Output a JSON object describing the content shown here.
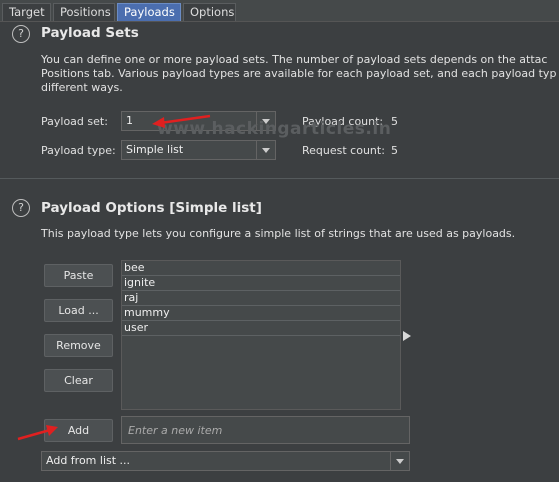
{
  "tabs": [
    {
      "label": "Target"
    },
    {
      "label": "Positions"
    },
    {
      "label": "Payloads"
    },
    {
      "label": "Options"
    }
  ],
  "payload_sets": {
    "title": "Payload Sets",
    "description_lines": [
      "You can define one or more payload sets. The number of payload sets depends on the attac",
      "Positions tab. Various payload types are available for each payload set, and each payload typ",
      "different ways."
    ],
    "payload_set_label": "Payload set:",
    "payload_set_value": "1",
    "payload_type_label": "Payload type:",
    "payload_type_value": "Simple list",
    "payload_count_label": "Payload count:",
    "payload_count": "5",
    "request_count_label": "Request count:",
    "request_count": "5"
  },
  "payload_options": {
    "title": "Payload Options [Simple list]",
    "description": "This payload type lets you configure a simple list of strings that are used as payloads.",
    "buttons": {
      "paste": "Paste",
      "load": "Load ...",
      "remove": "Remove",
      "clear": "Clear",
      "add": "Add"
    },
    "items": [
      "bee",
      "ignite",
      "raj",
      "mummy",
      "user"
    ],
    "new_item_placeholder": "Enter a new item",
    "add_from_list": "Add from list ..."
  },
  "watermark": "www.hackingarticles.in",
  "colors": {
    "background": "#3c3f41",
    "active_tab": "#4b6eaf",
    "annotation_arrow": "#e02020"
  }
}
